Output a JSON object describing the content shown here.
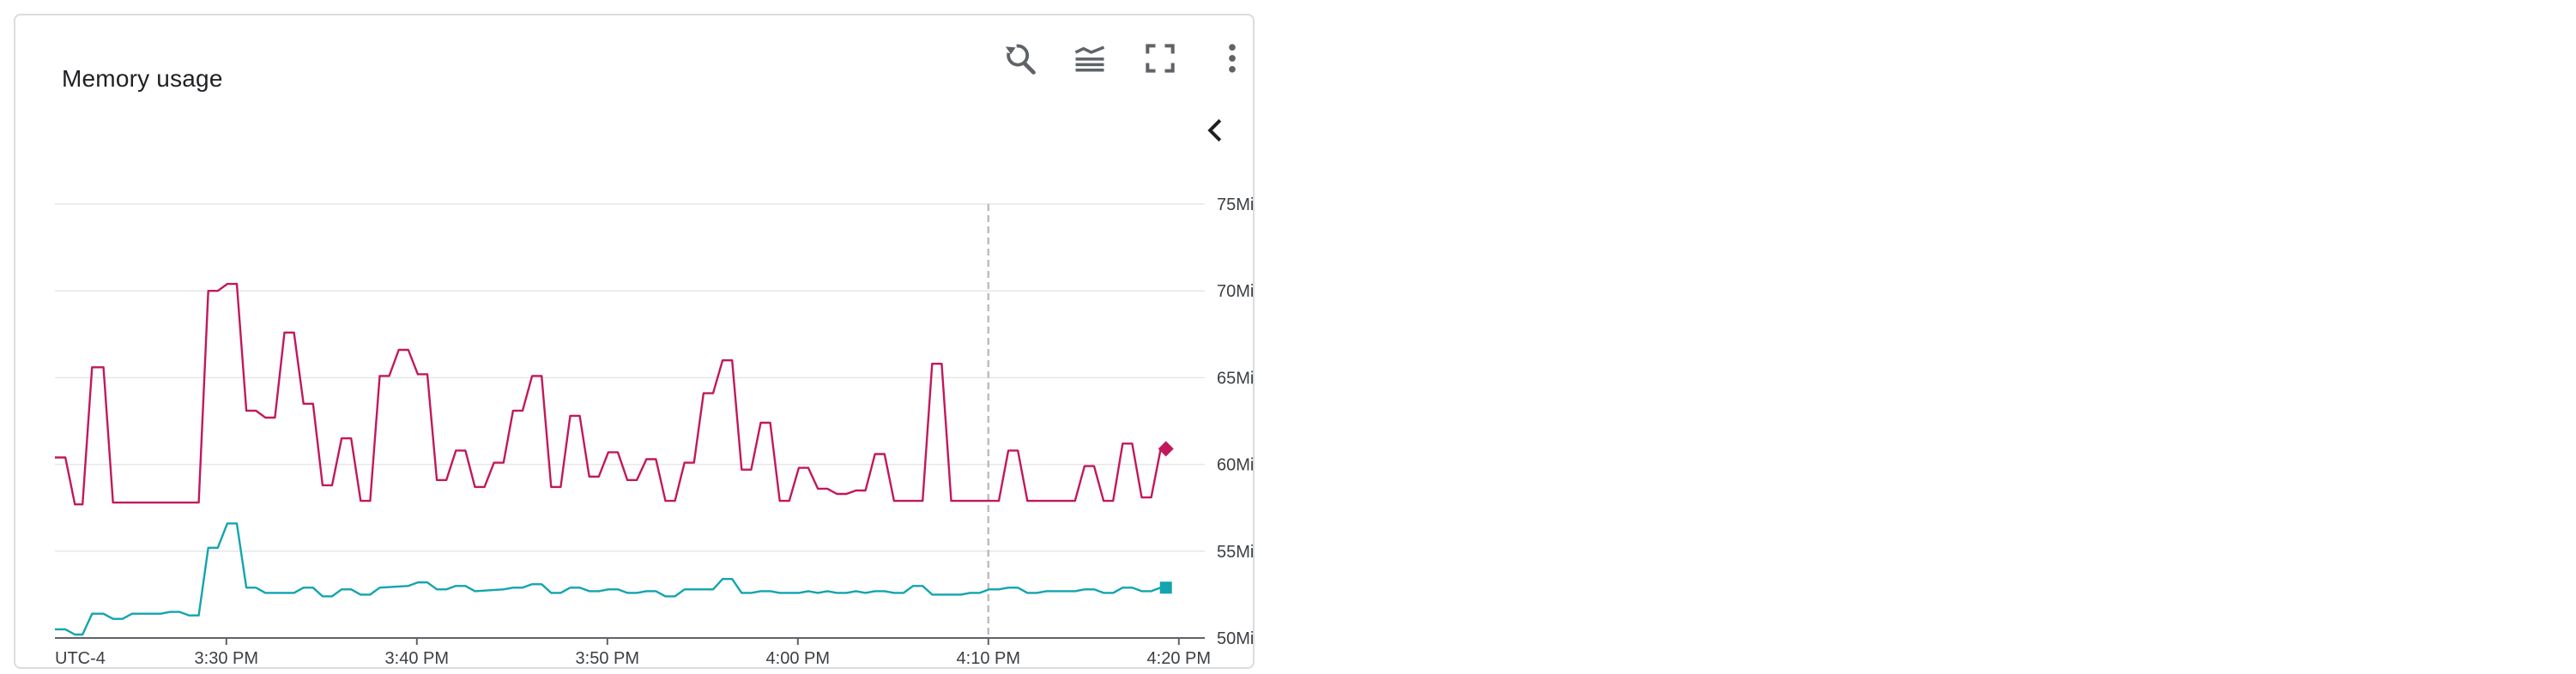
{
  "title": "Memory usage",
  "toolbar": {
    "icons": [
      "zoom-reset-icon",
      "legend-toggle-icon",
      "fullscreen-icon",
      "more-vert-icon"
    ],
    "collapse_icon": "chevron-left-icon"
  },
  "chart_data": {
    "type": "line",
    "timezone_label": "UTC-4",
    "x_tick_labels": [
      "3:30 PM",
      "3:40 PM",
      "3:50 PM",
      "4:00 PM",
      "4:10 PM",
      "4:20 PM"
    ],
    "y_tick_labels": [
      "75MiB",
      "70MiB",
      "65MiB",
      "60MiB",
      "55MiB",
      "50MiB"
    ],
    "ylim": [
      50,
      75
    ],
    "y_unit": "MiB",
    "grid": true,
    "hover_time": "4:10 PM",
    "series": [
      {
        "color": "#c2185b",
        "marker": "diamond",
        "points": [
          [
            0.0,
            60.4
          ],
          [
            0.55,
            60.4
          ],
          [
            1.05,
            57.7
          ],
          [
            1.45,
            57.7
          ],
          [
            1.95,
            65.6
          ],
          [
            2.55,
            65.6
          ],
          [
            3.05,
            57.8
          ],
          [
            7.55,
            57.8
          ],
          [
            8.05,
            70.0
          ],
          [
            8.55,
            70.0
          ],
          [
            9.05,
            70.4
          ],
          [
            9.55,
            70.4
          ],
          [
            10.05,
            63.1
          ],
          [
            10.55,
            63.1
          ],
          [
            11.05,
            62.7
          ],
          [
            11.55,
            62.7
          ],
          [
            12.05,
            67.6
          ],
          [
            12.55,
            67.6
          ],
          [
            13.05,
            63.5
          ],
          [
            13.55,
            63.5
          ],
          [
            14.05,
            58.8
          ],
          [
            14.55,
            58.8
          ],
          [
            15.05,
            61.5
          ],
          [
            15.55,
            61.5
          ],
          [
            16.05,
            57.9
          ],
          [
            16.55,
            57.9
          ],
          [
            17.05,
            65.1
          ],
          [
            17.55,
            65.1
          ],
          [
            18.05,
            66.6
          ],
          [
            18.55,
            66.6
          ],
          [
            19.05,
            65.2
          ],
          [
            19.55,
            65.2
          ],
          [
            20.05,
            59.1
          ],
          [
            20.55,
            59.1
          ],
          [
            21.05,
            60.8
          ],
          [
            21.55,
            60.8
          ],
          [
            22.05,
            58.7
          ],
          [
            22.55,
            58.7
          ],
          [
            23.05,
            60.1
          ],
          [
            23.55,
            60.1
          ],
          [
            24.05,
            63.1
          ],
          [
            24.55,
            63.1
          ],
          [
            25.05,
            65.1
          ],
          [
            25.55,
            65.1
          ],
          [
            26.05,
            58.7
          ],
          [
            26.55,
            58.7
          ],
          [
            27.05,
            62.8
          ],
          [
            27.55,
            62.8
          ],
          [
            28.05,
            59.3
          ],
          [
            28.55,
            59.3
          ],
          [
            29.05,
            60.7
          ],
          [
            29.55,
            60.7
          ],
          [
            30.05,
            59.1
          ],
          [
            30.55,
            59.1
          ],
          [
            31.05,
            60.3
          ],
          [
            31.55,
            60.3
          ],
          [
            32.05,
            57.9
          ],
          [
            32.55,
            57.9
          ],
          [
            33.05,
            60.1
          ],
          [
            33.55,
            60.1
          ],
          [
            34.05,
            64.1
          ],
          [
            34.55,
            64.1
          ],
          [
            35.05,
            66.0
          ],
          [
            35.55,
            66.0
          ],
          [
            36.05,
            59.7
          ],
          [
            36.55,
            59.7
          ],
          [
            37.05,
            62.4
          ],
          [
            37.55,
            62.4
          ],
          [
            38.05,
            57.9
          ],
          [
            38.55,
            57.9
          ],
          [
            39.05,
            59.8
          ],
          [
            39.55,
            59.8
          ],
          [
            40.05,
            58.6
          ],
          [
            40.55,
            58.6
          ],
          [
            41.05,
            58.3
          ],
          [
            41.55,
            58.3
          ],
          [
            42.05,
            58.5
          ],
          [
            42.55,
            58.5
          ],
          [
            43.05,
            60.6
          ],
          [
            43.55,
            60.6
          ],
          [
            44.05,
            57.9
          ],
          [
            45.55,
            57.9
          ],
          [
            46.05,
            65.8
          ],
          [
            46.55,
            65.8
          ],
          [
            47.05,
            57.9
          ],
          [
            49.55,
            57.9
          ],
          [
            50.05,
            60.8
          ],
          [
            50.55,
            60.8
          ],
          [
            51.05,
            57.9
          ],
          [
            53.55,
            57.9
          ],
          [
            54.05,
            59.9
          ],
          [
            54.55,
            59.9
          ],
          [
            55.05,
            57.9
          ],
          [
            55.55,
            57.9
          ],
          [
            56.05,
            61.2
          ],
          [
            56.55,
            61.2
          ],
          [
            57.05,
            58.1
          ],
          [
            57.55,
            58.1
          ],
          [
            58.05,
            60.9
          ]
        ]
      },
      {
        "color": "#12a4af",
        "marker": "square",
        "points": [
          [
            0.0,
            50.5
          ],
          [
            0.55,
            50.5
          ],
          [
            1.05,
            50.2
          ],
          [
            1.45,
            50.2
          ],
          [
            1.95,
            51.4
          ],
          [
            2.55,
            51.4
          ],
          [
            3.05,
            51.1
          ],
          [
            3.55,
            51.1
          ],
          [
            4.05,
            51.4
          ],
          [
            5.55,
            51.4
          ],
          [
            6.05,
            51.5
          ],
          [
            6.55,
            51.5
          ],
          [
            7.05,
            51.3
          ],
          [
            7.55,
            51.3
          ],
          [
            8.05,
            55.2
          ],
          [
            8.55,
            55.2
          ],
          [
            9.05,
            56.6
          ],
          [
            9.55,
            56.6
          ],
          [
            10.05,
            52.9
          ],
          [
            10.55,
            52.9
          ],
          [
            11.05,
            52.6
          ],
          [
            12.55,
            52.6
          ],
          [
            13.05,
            52.9
          ],
          [
            13.55,
            52.9
          ],
          [
            14.05,
            52.4
          ],
          [
            14.55,
            52.4
          ],
          [
            15.05,
            52.8
          ],
          [
            15.55,
            52.8
          ],
          [
            16.05,
            52.5
          ],
          [
            16.55,
            52.5
          ],
          [
            17.05,
            52.9
          ],
          [
            18.55,
            53.0
          ],
          [
            19.05,
            53.2
          ],
          [
            19.55,
            53.2
          ],
          [
            20.05,
            52.8
          ],
          [
            20.55,
            52.8
          ],
          [
            21.05,
            53.0
          ],
          [
            21.55,
            53.0
          ],
          [
            22.05,
            52.7
          ],
          [
            23.55,
            52.8
          ],
          [
            24.05,
            52.9
          ],
          [
            24.55,
            52.9
          ],
          [
            25.05,
            53.1
          ],
          [
            25.55,
            53.1
          ],
          [
            26.05,
            52.6
          ],
          [
            26.55,
            52.6
          ],
          [
            27.05,
            52.9
          ],
          [
            27.55,
            52.9
          ],
          [
            28.05,
            52.7
          ],
          [
            28.55,
            52.7
          ],
          [
            29.05,
            52.8
          ],
          [
            29.55,
            52.8
          ],
          [
            30.05,
            52.6
          ],
          [
            30.55,
            52.6
          ],
          [
            31.05,
            52.7
          ],
          [
            31.55,
            52.7
          ],
          [
            32.05,
            52.4
          ],
          [
            32.55,
            52.4
          ],
          [
            33.05,
            52.8
          ],
          [
            34.55,
            52.8
          ],
          [
            35.05,
            53.4
          ],
          [
            35.55,
            53.4
          ],
          [
            36.05,
            52.6
          ],
          [
            36.55,
            52.6
          ],
          [
            37.05,
            52.7
          ],
          [
            37.55,
            52.7
          ],
          [
            38.05,
            52.6
          ],
          [
            39.05,
            52.6
          ],
          [
            39.55,
            52.7
          ],
          [
            40.05,
            52.6
          ],
          [
            40.55,
            52.7
          ],
          [
            41.05,
            52.6
          ],
          [
            41.55,
            52.6
          ],
          [
            42.05,
            52.7
          ],
          [
            42.55,
            52.6
          ],
          [
            43.05,
            52.7
          ],
          [
            43.55,
            52.7
          ],
          [
            44.05,
            52.6
          ],
          [
            44.55,
            52.6
          ],
          [
            45.05,
            53.0
          ],
          [
            45.55,
            53.0
          ],
          [
            46.05,
            52.5
          ],
          [
            47.55,
            52.5
          ],
          [
            48.05,
            52.6
          ],
          [
            48.55,
            52.6
          ],
          [
            49.05,
            52.8
          ],
          [
            49.55,
            52.8
          ],
          [
            50.05,
            52.9
          ],
          [
            50.55,
            52.9
          ],
          [
            51.05,
            52.6
          ],
          [
            51.55,
            52.6
          ],
          [
            52.05,
            52.7
          ],
          [
            53.55,
            52.7
          ],
          [
            54.05,
            52.8
          ],
          [
            54.55,
            52.8
          ],
          [
            55.05,
            52.6
          ],
          [
            55.55,
            52.6
          ],
          [
            56.05,
            52.9
          ],
          [
            56.55,
            52.9
          ],
          [
            57.05,
            52.7
          ],
          [
            57.55,
            52.7
          ],
          [
            58.05,
            52.9
          ]
        ]
      }
    ]
  }
}
